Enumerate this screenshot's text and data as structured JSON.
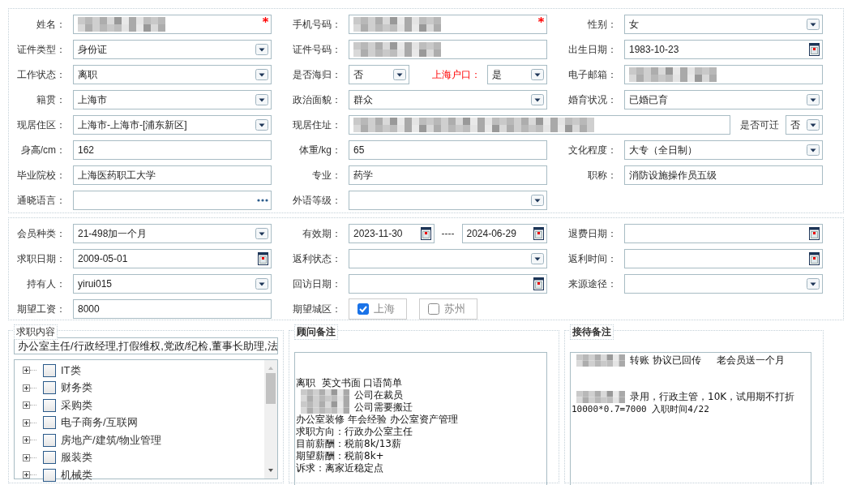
{
  "sections": [
    {
      "rows": [
        [
          {
            "label": "姓名：",
            "controls": [
              {
                "kind": "text",
                "redacted": true,
                "required": true
              }
            ]
          },
          {
            "label": "手机号码：",
            "controls": [
              {
                "kind": "text",
                "redacted": true,
                "required": true
              }
            ]
          },
          {
            "label": "性别：",
            "controls": [
              {
                "kind": "select",
                "value": "女"
              }
            ]
          }
        ],
        [
          {
            "label": "证件类型：",
            "controls": [
              {
                "kind": "select",
                "value": "身份证"
              }
            ]
          },
          {
            "label": "证件号码：",
            "controls": [
              {
                "kind": "text",
                "redacted": true
              }
            ]
          },
          {
            "label": "出生日期：",
            "controls": [
              {
                "kind": "date",
                "value": "1983-10-23"
              }
            ]
          }
        ],
        [
          {
            "label": "工作状态：",
            "controls": [
              {
                "kind": "select",
                "value": "离职"
              }
            ]
          },
          {
            "label": "是否海归：",
            "controls": [
              {
                "kind": "select",
                "value": "否"
              },
              {
                "kind": "label",
                "text": "上海户口：",
                "alert": true
              },
              {
                "kind": "select",
                "value": "是"
              }
            ]
          },
          {
            "label": "电子邮箱：",
            "controls": [
              {
                "kind": "text",
                "redacted": true
              }
            ]
          }
        ],
        [
          {
            "label": "籍贯：",
            "controls": [
              {
                "kind": "select",
                "value": "上海市"
              }
            ]
          },
          {
            "label": "政治面貌：",
            "controls": [
              {
                "kind": "select",
                "value": "群众"
              }
            ]
          },
          {
            "label": "婚育状况：",
            "controls": [
              {
                "kind": "select",
                "value": "已婚已育"
              }
            ]
          }
        ],
        [
          {
            "label": "现居住区：",
            "controls": [
              {
                "kind": "select",
                "value": "上海市-上海市-[浦东新区]"
              }
            ]
          },
          {
            "label": "现居住址：",
            "wide": true,
            "controls": [
              {
                "kind": "text",
                "redacted": true
              },
              {
                "kind": "label",
                "text": "是否可迁",
                "alert": false
              },
              {
                "kind": "select",
                "value": "否"
              }
            ]
          }
        ],
        [
          {
            "label": "身高/cm：",
            "controls": [
              {
                "kind": "text",
                "value": "162"
              }
            ]
          },
          {
            "label": "体重/kg：",
            "controls": [
              {
                "kind": "text",
                "value": "65"
              }
            ]
          },
          {
            "label": "文化程度：",
            "controls": [
              {
                "kind": "select",
                "value": "大专（全日制）"
              }
            ]
          }
        ],
        [
          {
            "label": "毕业院校：",
            "controls": [
              {
                "kind": "text",
                "value": "上海医药职工大学"
              }
            ]
          },
          {
            "label": "专业：",
            "controls": [
              {
                "kind": "text",
                "value": "药学"
              }
            ]
          },
          {
            "label": "职称：",
            "controls": [
              {
                "kind": "text",
                "value": "消防设施操作员五级"
              }
            ]
          }
        ],
        [
          {
            "label": "通晓语言：",
            "controls": [
              {
                "kind": "lookup"
              }
            ]
          },
          {
            "label": "外语等级：",
            "controls": [
              {
                "kind": "select"
              }
            ]
          }
        ]
      ]
    },
    {
      "rows": [
        [
          {
            "label": "会员种类：",
            "controls": [
              {
                "kind": "select",
                "value": "21-498加一个月"
              }
            ]
          },
          {
            "label": "有效期：",
            "controls": [
              {
                "kind": "date",
                "value": "2023-11-30"
              },
              {
                "kind": "separator",
                "text": "----"
              },
              {
                "kind": "date",
                "value": "2024-06-29"
              }
            ]
          },
          {
            "label": "退费日期：",
            "controls": [
              {
                "kind": "date"
              }
            ]
          }
        ],
        [
          {
            "label": "求职日期：",
            "controls": [
              {
                "kind": "date",
                "value": "2009-05-01"
              }
            ]
          },
          {
            "label": "返利状态：",
            "controls": [
              {
                "kind": "select"
              }
            ]
          },
          {
            "label": "返利时间：",
            "controls": [
              {
                "kind": "date"
              }
            ]
          }
        ],
        [
          {
            "label": "持有人：",
            "controls": [
              {
                "kind": "select",
                "value": "yirui015"
              }
            ]
          },
          {
            "label": "回访日期：",
            "controls": [
              {
                "kind": "date"
              }
            ]
          },
          {
            "label": "来源途径：",
            "controls": [
              {
                "kind": "select"
              }
            ]
          }
        ],
        [
          {
            "label": "期望工资：",
            "controls": [
              {
                "kind": "text",
                "value": "8000"
              }
            ]
          },
          {
            "label": "期望城区：",
            "controls": [
              {
                "kind": "check",
                "text": "上海",
                "checked": true
              },
              {
                "kind": "check",
                "text": "苏州",
                "checked": false
              }
            ]
          }
        ]
      ]
    }
  ],
  "panels": [
    {
      "kind": "tree",
      "legend": "求职内容",
      "input": "办公室主任/行政经理,打假维权,党政/纪检,董事长助理,法",
      "items": [
        {
          "label": "IT类",
          "checked": false,
          "expanded": false
        },
        {
          "label": "财务类",
          "checked": false,
          "expanded": false
        },
        {
          "label": "采购类",
          "checked": false,
          "expanded": false
        },
        {
          "label": "电子商务/互联网",
          "checked": false,
          "expanded": false
        },
        {
          "label": "房地产/建筑/物业管理",
          "checked": false,
          "expanded": false
        },
        {
          "label": "服装类",
          "checked": false,
          "expanded": false
        },
        {
          "label": "机械类",
          "checked": false,
          "expanded": false
        }
      ]
    },
    {
      "kind": "note",
      "legend": "顾问备注",
      "blocks": [
        [
          {
            "text": "离职  英文书面 口语简单"
          },
          {
            "redacted": true,
            "text": "公司在裁员"
          },
          {
            "redacted": true,
            "text": "公司需要搬迁"
          },
          {
            "text": "办公室装修 年会经验 办公室资产管理"
          },
          {
            "text": "求职方向：行政办公室主任"
          },
          {
            "text": "目前薪酬：税前8k/13薪"
          },
          {
            "text": "期望薪酬：税前8k+"
          },
          {
            "text": "诉求：离家近稳定点"
          }
        ]
      ]
    },
    {
      "kind": "note",
      "legend": "接待备注",
      "blocks": [
        [
          {
            "redacted": true,
            "text": "转账 协议已回传     老会员送一个月"
          }
        ],
        [
          {
            "redacted": true,
            "text": "录用，行政主管，10K，试用期不打折"
          },
          {
            "text": "10000*0.7=7000 入职时间4/22"
          }
        ]
      ]
    }
  ]
}
